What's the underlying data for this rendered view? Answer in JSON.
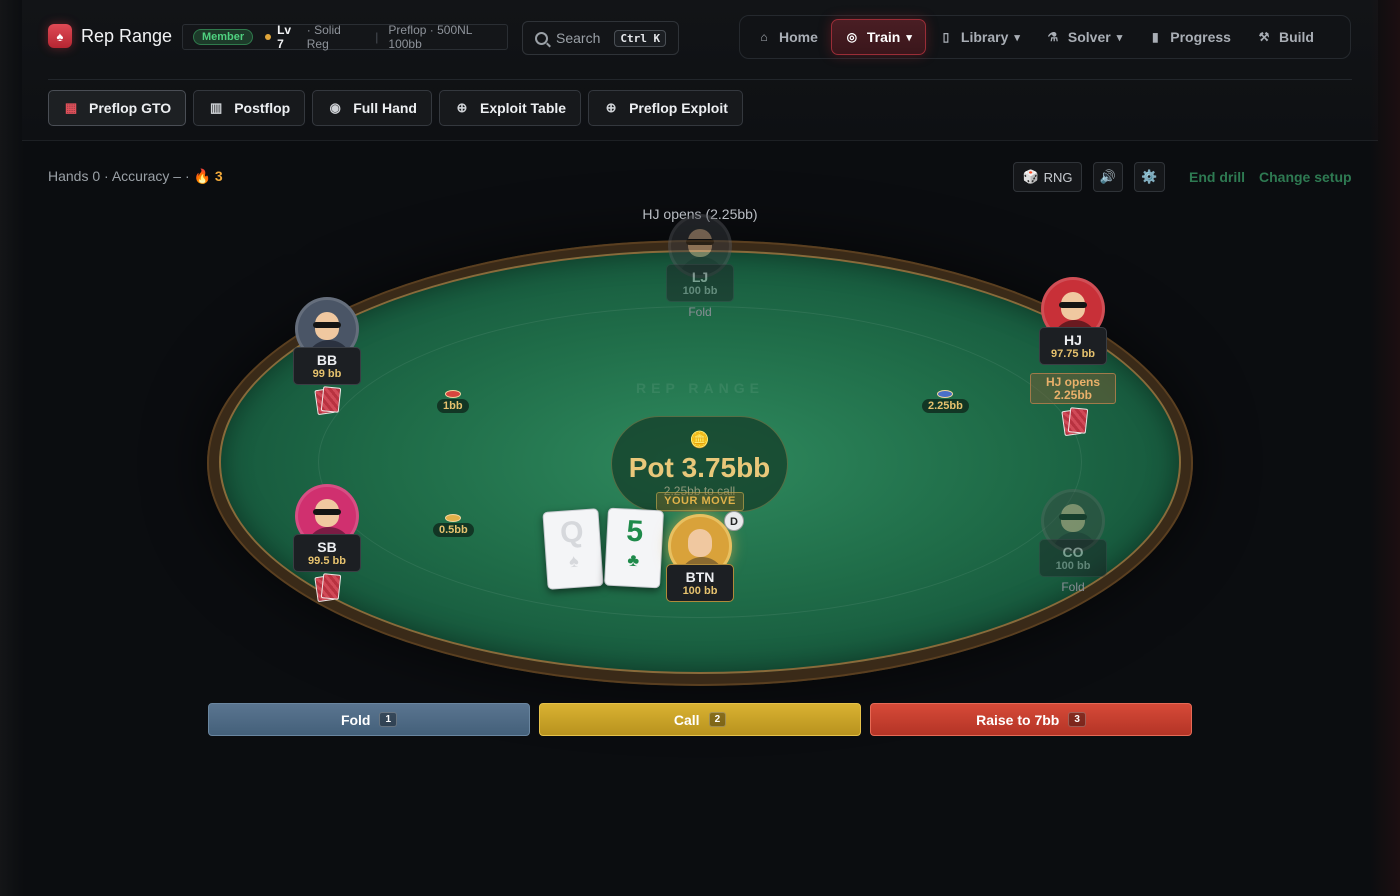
{
  "brand": {
    "name": "Rep Range",
    "logo_icon": "♠"
  },
  "member": {
    "badge": "Member",
    "level": "Lv 7",
    "rank": "· Solid Reg",
    "separator": "|",
    "format": "Preflop · 500NL 100bb"
  },
  "search": {
    "label": "Search",
    "shortcut": "Ctrl K"
  },
  "nav": [
    {
      "label": "Home",
      "icon": "home-icon",
      "active": false
    },
    {
      "label": "Train",
      "icon": "target-icon",
      "active": true,
      "dropdown": true
    },
    {
      "label": "Library",
      "icon": "book-icon",
      "active": false,
      "dropdown": true
    },
    {
      "label": "Solver",
      "icon": "flask-icon",
      "active": false,
      "dropdown": true
    },
    {
      "label": "Progress",
      "icon": "bar-chart-icon",
      "active": false
    },
    {
      "label": "Build",
      "icon": "hammer-icon",
      "active": false
    }
  ],
  "modes": [
    {
      "label": "Preflop GTO",
      "icon": "grid-icon",
      "active": true
    },
    {
      "label": "Postflop",
      "icon": "cards-icon",
      "active": false
    },
    {
      "label": "Full Hand",
      "icon": "eye-icon",
      "active": false
    },
    {
      "label": "Exploit Table",
      "icon": "crosshair-icon",
      "active": false
    },
    {
      "label": "Preflop Exploit",
      "icon": "crosshair-icon",
      "active": false
    }
  ],
  "stats": {
    "text": "Hands 0 · Accuracy – · ",
    "streak_icon": "🔥",
    "streak": "3"
  },
  "controls": {
    "rng": "RNG",
    "rng_icon": "🎲",
    "sound_icon": "🔊",
    "settings_icon": "⚙️",
    "end_drill": "End drill",
    "change_setup": "Change setup"
  },
  "table": {
    "caption": "HJ opens (2.25bb)",
    "watermark": "REP RANGE",
    "pot_label": "Pot 3.75bb",
    "pot_sub": "2.25bb to call",
    "your_move": "YOUR MOVE",
    "dealer": "D"
  },
  "seats": {
    "lj": {
      "name": "LJ",
      "stack": "100 bb",
      "status": "Fold"
    },
    "bb": {
      "name": "BB",
      "stack": "99 bb"
    },
    "hj": {
      "name": "HJ",
      "stack": "97.75 bb",
      "action": "HJ opens 2.25bb"
    },
    "sb": {
      "name": "SB",
      "stack": "99.5 bb"
    },
    "co": {
      "name": "CO",
      "stack": "100 bb",
      "status": "Fold"
    },
    "btn": {
      "name": "BTN",
      "stack": "100 bb"
    }
  },
  "bets": {
    "bb": "1bb",
    "hj": "2.25bb",
    "sb": "0.5bb"
  },
  "hero_cards": [
    {
      "rank": "Q",
      "suit": "♠",
      "color": "#111111"
    },
    {
      "rank": "5",
      "suit": "♣",
      "color": "#1e8a4a"
    }
  ],
  "actions": [
    {
      "label": "Fold",
      "hotkey": "1"
    },
    {
      "label": "Call",
      "hotkey": "2"
    },
    {
      "label": "Raise to 7bb",
      "hotkey": "3"
    }
  ]
}
